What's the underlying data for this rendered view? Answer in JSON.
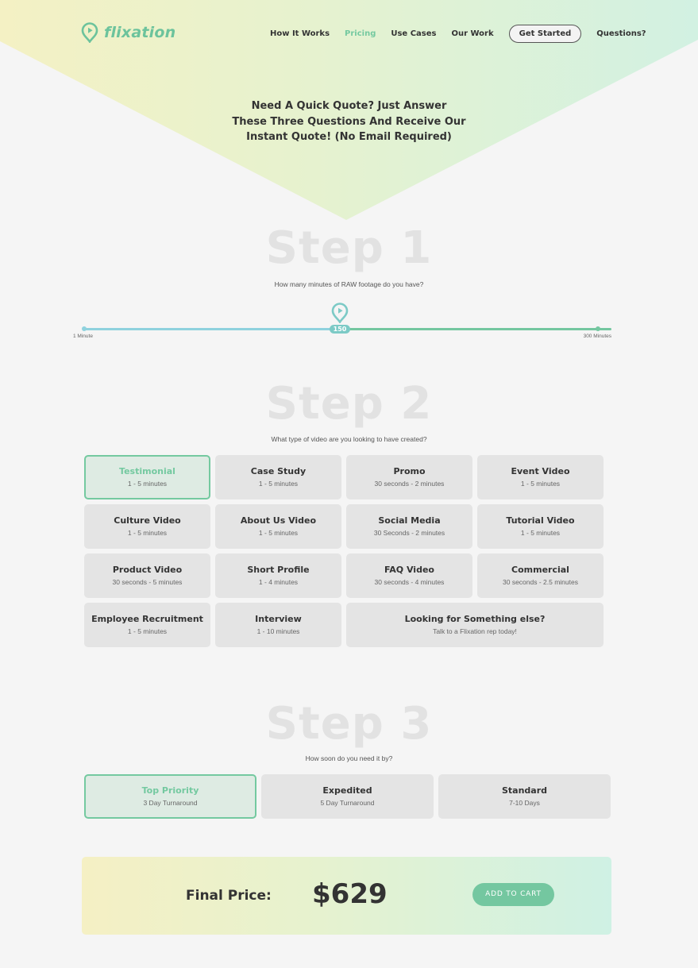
{
  "brand": {
    "name": "flixation",
    "accent": "#74c9a0",
    "logo_icon": "location-pin-play-icon"
  },
  "nav": {
    "items": [
      {
        "label": "How It Works",
        "active": false
      },
      {
        "label": "Pricing",
        "active": true
      },
      {
        "label": "Use Cases",
        "active": false
      },
      {
        "label": "Our Work",
        "active": false
      }
    ],
    "cta_label": "Get Started",
    "questions_label": "Questions?"
  },
  "hero": {
    "lines": [
      "Need A Quick Quote? Just Answer",
      "These Three Questions And Receive Our",
      "Instant Quote! (No Email Required)"
    ]
  },
  "step1": {
    "title": "Step 1",
    "question": "How many minutes of RAW footage do you have?",
    "slider": {
      "min": 1,
      "max": 300,
      "value": 150,
      "value_label": "150",
      "min_label": "1 Minute",
      "max_label": "300 Minutes"
    }
  },
  "step2": {
    "title": "Step 2",
    "question": "What type of video are you looking to have created?",
    "options": [
      {
        "title": "Testimonial",
        "sub": "1 - 5 minutes",
        "selected": true
      },
      {
        "title": "Case Study",
        "sub": "1 - 5 minutes",
        "selected": false
      },
      {
        "title": "Promo",
        "sub": "30 seconds - 2 minutes",
        "selected": false
      },
      {
        "title": "Event Video",
        "sub": "1 - 5 minutes",
        "selected": false
      },
      {
        "title": "Culture Video",
        "sub": "1 - 5 minutes",
        "selected": false
      },
      {
        "title": "About Us Video",
        "sub": "1 - 5 minutes",
        "selected": false
      },
      {
        "title": "Social Media",
        "sub": "30 Seconds - 2 minutes",
        "selected": false
      },
      {
        "title": "Tutorial Video",
        "sub": "1 - 5 minutes",
        "selected": false
      },
      {
        "title": "Product Video",
        "sub": "30 seconds - 5 minutes",
        "selected": false
      },
      {
        "title": "Short Profile",
        "sub": "1 - 4 minutes",
        "selected": false
      },
      {
        "title": "FAQ Video",
        "sub": "30 seconds - 4 minutes",
        "selected": false
      },
      {
        "title": "Commercial",
        "sub": "30 seconds - 2.5 minutes",
        "selected": false
      },
      {
        "title": "Employee Recruitment",
        "sub": "1 - 5 minutes",
        "selected": false
      },
      {
        "title": "Interview",
        "sub": "1 - 10 minutes",
        "selected": false
      },
      {
        "title": "Looking for Something else?",
        "sub": "Talk to a Flixation rep today!",
        "selected": false
      }
    ]
  },
  "step3": {
    "title": "Step 3",
    "question": "How soon do you need it by?",
    "options": [
      {
        "title": "Top Priority",
        "sub": "3 Day Turnaround",
        "selected": true
      },
      {
        "title": "Expedited",
        "sub": "5 Day Turnaround",
        "selected": false
      },
      {
        "title": "Standard",
        "sub": "7-10 Days",
        "selected": false
      }
    ]
  },
  "final": {
    "label": "Final Price:",
    "price": "$629",
    "cart_label": "ADD TO CART"
  }
}
